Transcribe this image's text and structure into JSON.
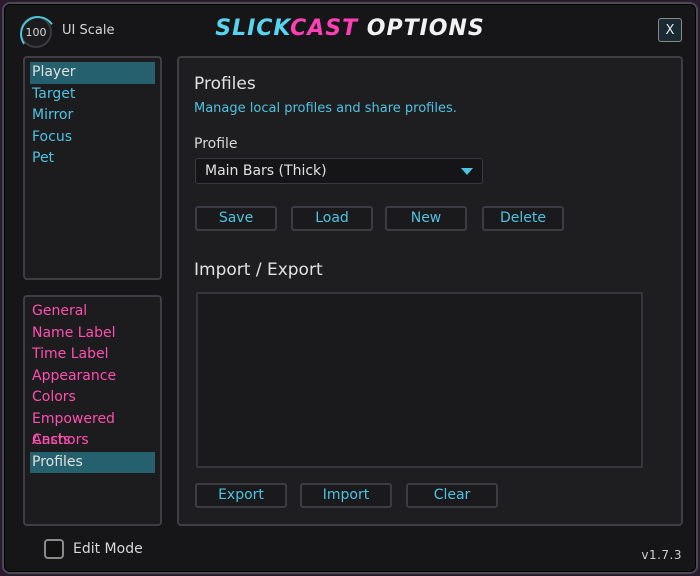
{
  "header": {
    "ui_scale_value": "100",
    "ui_scale_label": "UI Scale",
    "title_part1": "SLICK",
    "title_part2": "CAST",
    "title_part3": " OPTIONS",
    "close_label": "X"
  },
  "units": [
    {
      "label": "Player",
      "active": true
    },
    {
      "label": "Target",
      "active": false
    },
    {
      "label": "Mirror",
      "active": false
    },
    {
      "label": "Focus",
      "active": false
    },
    {
      "label": "Pet",
      "active": false
    }
  ],
  "sections": [
    {
      "label": "General",
      "active": false
    },
    {
      "label": "Name Label",
      "active": false
    },
    {
      "label": "Time Label",
      "active": false
    },
    {
      "label": "Appearance",
      "active": false
    },
    {
      "label": "Colors",
      "active": false
    },
    {
      "label": "Empowered Casts",
      "active": false
    },
    {
      "label": "Anchors",
      "active": false
    },
    {
      "label": "Profiles",
      "active": true
    }
  ],
  "footer": {
    "edit_mode_label": "Edit Mode",
    "edit_mode_checked": false,
    "version": "v1.7.3"
  },
  "main": {
    "profiles_heading": "Profiles",
    "profiles_description": "Manage local profiles and share profiles.",
    "profile_label": "Profile",
    "profile_selected": "Main Bars (Thick)",
    "save_label": "Save",
    "load_label": "Load",
    "new_label": "New",
    "delete_label": "Delete",
    "import_export_heading": "Import / Export",
    "import_export_value": "",
    "export_label": "Export",
    "import_label": "Import",
    "clear_label": "Clear"
  },
  "colors": {
    "accent_cyan": "#4fc3e0",
    "accent_pink": "#ff4fb0",
    "active_row": "#25606e",
    "window_bg": "#161618"
  }
}
